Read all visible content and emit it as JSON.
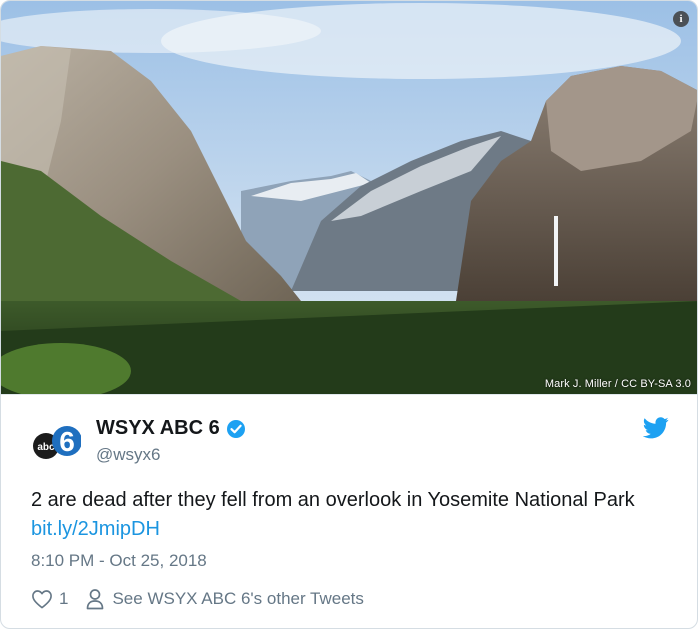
{
  "image": {
    "credit": "Mark J. Miller / CC BY-SA 3.0",
    "info_icon": "info-icon"
  },
  "tweet": {
    "display_name": "WSYX ABC 6",
    "handle": "@wsyx6",
    "verified_icon": "verified-badge-icon",
    "text": "2 are dead after they fell from an overlook in Yosemite National Park ",
    "link": "bit.ly/2JmipDH",
    "timestamp": "8:10 PM - Oct 25, 2018",
    "like_count": "1",
    "other_tweets_label": "See WSYX ABC 6's other Tweets"
  },
  "colors": {
    "accent": "#1b95e0",
    "text": "#14171a",
    "muted": "#657786"
  }
}
